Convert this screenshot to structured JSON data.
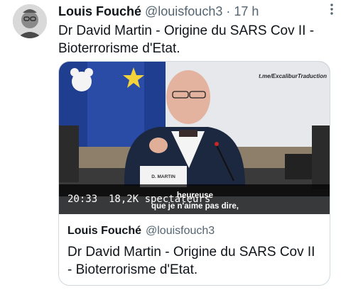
{
  "tweet": {
    "author_name": "Louis Fouché",
    "author_handle": "@louisfouch3",
    "separator": "·",
    "time": "17 h",
    "text": "Dr David Martin - Origine du SARS Cov II - Bioterrorisme d'Etat."
  },
  "video": {
    "watermark": "t.me/ExcaliburTraduction",
    "name_card": "D. MARTIN",
    "subtitle_line1": "heureuse",
    "subtitle_line2": "que je n'aime pas dire,",
    "duration": "20:33",
    "views": "18,2K spectateurs"
  },
  "quote": {
    "author_name": "Louis Fouché",
    "author_handle": "@louisfouch3",
    "text": "Dr David Martin - Origine du SARS Cov II - Bioterrorisme d'Etat."
  },
  "colors": {
    "text_primary": "#0f1419",
    "text_secondary": "#536471",
    "border": "#cfd9de"
  },
  "icons": {
    "more": "more-vertical-icon",
    "avatar": "user-avatar",
    "video_thumbnail": "video-thumbnail"
  }
}
